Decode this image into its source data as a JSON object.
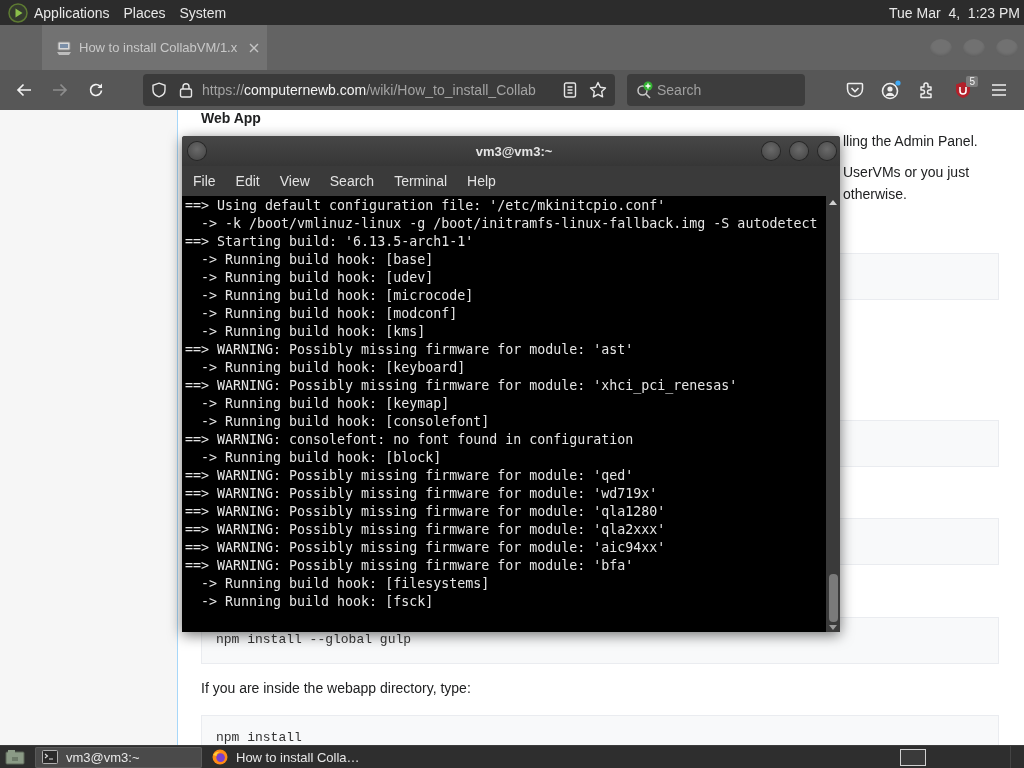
{
  "top_panel": {
    "menus": [
      "Applications",
      "Places",
      "System"
    ],
    "clock": "Tue Mar  4,  1:23 PM"
  },
  "browser": {
    "tabs": [
      {
        "title": "How to install CollabVM/1.x",
        "selected": true
      }
    ],
    "nav_buttons": [
      {
        "kind": "back",
        "disabled": false
      },
      {
        "kind": "forward",
        "disabled": true
      },
      {
        "kind": "reload",
        "disabled": false
      }
    ],
    "address": {
      "scheme": "https://",
      "host": "computernewb.com",
      "path": "/wiki/How_to_install_Collab"
    },
    "search": {
      "placeholder": "Search"
    },
    "toolbar_icons": [
      {
        "kind": "pocket"
      },
      {
        "kind": "account"
      },
      {
        "kind": "extensions"
      },
      {
        "kind": "blocker",
        "badge": "5"
      },
      {
        "kind": "menu"
      }
    ]
  },
  "page": {
    "content": [
      {
        "kind": "heading",
        "text": "Web App"
      },
      {
        "kind": "fragment",
        "text": "lling the Admin Panel."
      },
      {
        "kind": "fragment",
        "text": "UserVMs or you just"
      },
      {
        "kind": "fragment",
        "text": "otherwise."
      },
      {
        "kind": "code"
      },
      {
        "kind": "code"
      },
      {
        "kind": "code"
      },
      {
        "kind": "code",
        "text": "npm install --global gulp"
      },
      {
        "kind": "paragraph",
        "text": "If you are inside the webapp directory, type:"
      },
      {
        "kind": "code",
        "text": "npm install"
      }
    ]
  },
  "terminal": {
    "title": "vm3@vm3:~",
    "menus": [
      "File",
      "Edit",
      "View",
      "Search",
      "Terminal",
      "Help"
    ],
    "lines": [
      "==> Using default configuration file: '/etc/mkinitcpio.conf'",
      "  -> -k /boot/vmlinuz-linux -g /boot/initramfs-linux-fallback.img -S autodetect",
      "==> Starting build: '6.13.5-arch1-1'",
      "  -> Running build hook: [base]",
      "  -> Running build hook: [udev]",
      "  -> Running build hook: [microcode]",
      "  -> Running build hook: [modconf]",
      "  -> Running build hook: [kms]",
      "==> WARNING: Possibly missing firmware for module: 'ast'",
      "  -> Running build hook: [keyboard]",
      "==> WARNING: Possibly missing firmware for module: 'xhci_pci_renesas'",
      "  -> Running build hook: [keymap]",
      "  -> Running build hook: [consolefont]",
      "==> WARNING: consolefont: no font found in configuration",
      "  -> Running build hook: [block]",
      "==> WARNING: Possibly missing firmware for module: 'qed'",
      "==> WARNING: Possibly missing firmware for module: 'wd719x'",
      "==> WARNING: Possibly missing firmware for module: 'qla1280'",
      "==> WARNING: Possibly missing firmware for module: 'qla2xxx'",
      "==> WARNING: Possibly missing firmware for module: 'aic94xx'",
      "==> WARNING: Possibly missing firmware for module: 'bfa'",
      "  -> Running build hook: [filesystems]",
      "  -> Running build hook: [fsck]"
    ]
  },
  "taskbar": {
    "tasks": [
      {
        "kind": "terminal",
        "label": "vm3@vm3:~",
        "selected": true
      },
      {
        "kind": "browser",
        "label": "How to install Colla…",
        "selected": false
      }
    ]
  }
}
